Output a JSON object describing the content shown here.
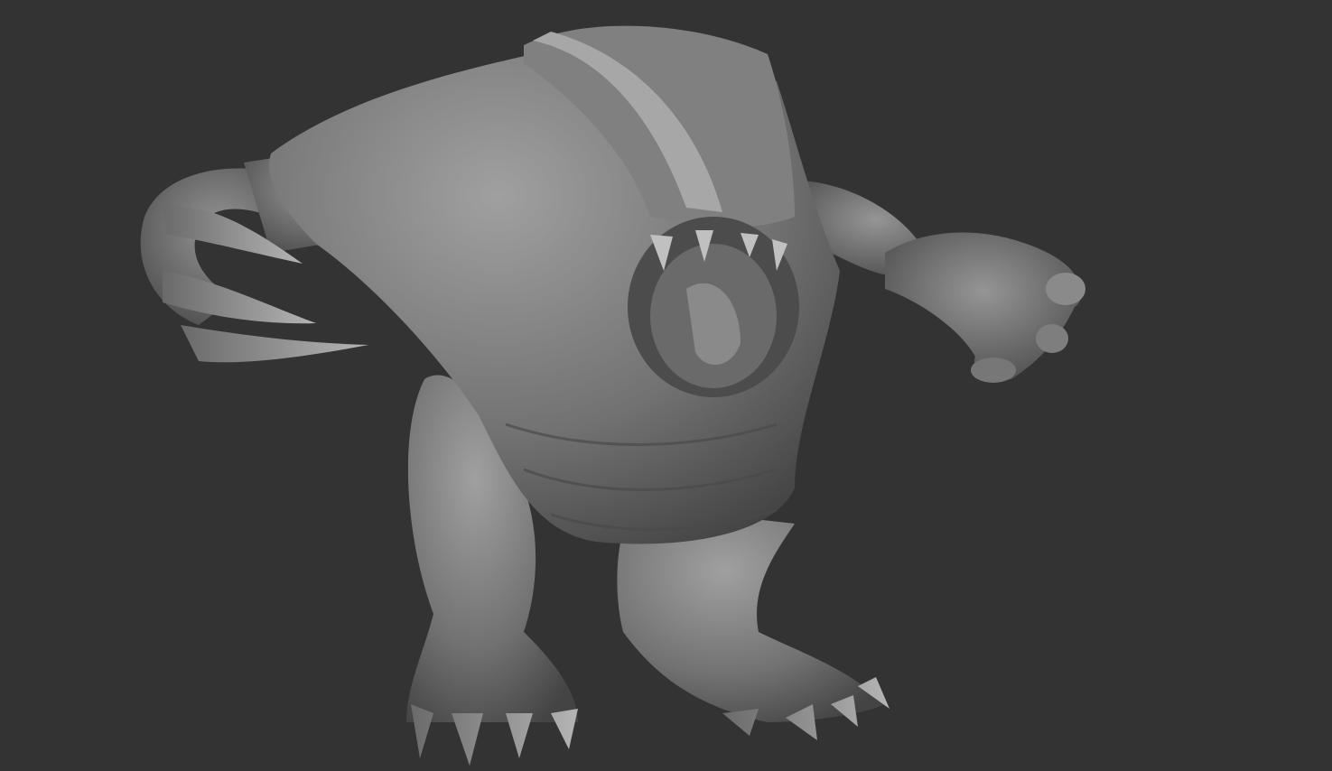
{
  "viewport": {
    "subject": "sculpted-creature-model",
    "colors": {
      "background": "#333333",
      "material_light": "#9a9a9a",
      "material_mid": "#6e6e6e",
      "material_dark": "#3e3e3e"
    }
  }
}
